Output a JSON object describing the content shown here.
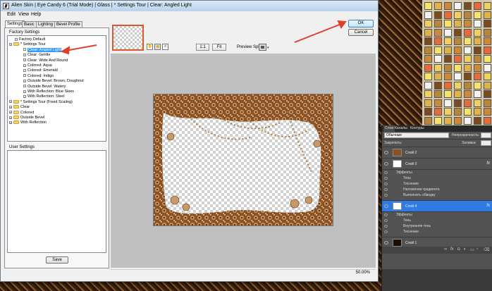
{
  "window": {
    "title": "Alien Skin | Eye Candy 6 (Trial Mode) | Glass | * Settings Tour | Clear: Angled Light"
  },
  "menu": {
    "edit": "Edit",
    "view": "View",
    "help": "Help"
  },
  "tabs": [
    "Settings",
    "Basic",
    "Lighting",
    "Bevel Profile"
  ],
  "factory_settings": {
    "label": "Factory Settings",
    "items": [
      {
        "label": "Factory Default",
        "type": "leaf",
        "indent": 1
      },
      {
        "label": "* Settings Tour",
        "type": "folder-open",
        "indent": 0
      },
      {
        "label": "Clear: Angled Light",
        "type": "leaf",
        "indent": 2,
        "selected": true
      },
      {
        "label": "Clear: Gentle",
        "type": "leaf",
        "indent": 2
      },
      {
        "label": "Clear: Wide And Round",
        "type": "leaf",
        "indent": 2
      },
      {
        "label": "Colored: Aqua",
        "type": "leaf",
        "indent": 2
      },
      {
        "label": "Colored: Emerald",
        "type": "leaf",
        "indent": 2
      },
      {
        "label": "Colored: Indigo",
        "type": "leaf",
        "indent": 2
      },
      {
        "label": "Outside Bevel: Brown, Doughnut",
        "type": "leaf",
        "indent": 2
      },
      {
        "label": "Outside Bevel: Watery",
        "type": "leaf",
        "indent": 2
      },
      {
        "label": "With Reflection: Blue Skies",
        "type": "leaf",
        "indent": 2
      },
      {
        "label": "With Reflection: Steel",
        "type": "leaf",
        "indent": 2
      },
      {
        "label": "* Settings Tour (Fixed Scaling)",
        "type": "folder",
        "indent": 0
      },
      {
        "label": "Clear",
        "type": "folder",
        "indent": 0
      },
      {
        "label": "Colored",
        "type": "folder",
        "indent": 0
      },
      {
        "label": "Outside Bevel",
        "type": "folder",
        "indent": 0
      },
      {
        "label": "With Reflection",
        "type": "folder",
        "indent": 0
      }
    ]
  },
  "user_settings": {
    "label": "User Settings"
  },
  "save_button": "Save",
  "ok_button": "OK",
  "cancel_button": "Cancel",
  "toolbar": {
    "zoom_1_1": "1:1",
    "fit": "Fit",
    "preview_split_label": "Preview Split:"
  },
  "status": {
    "zoom": "50.00%"
  },
  "ps": {
    "tabs": [
      "Слои",
      "Каналы",
      "Контуры"
    ],
    "blend_mode": "Обычные",
    "opacity_label": "Непрозрачность:",
    "lock_label": "Закрепить:",
    "fill_label": "Заливка:",
    "layers": [
      {
        "name": "Слой 2",
        "fx": false
      },
      {
        "name": "Слой 3",
        "fx": true,
        "effects_label": "Эффекты",
        "effects": [
          "Тень",
          "Тиснение",
          "Наложение градиента",
          "Выполнить обводку"
        ]
      },
      {
        "name": "Слой 4",
        "fx": true,
        "selected": true,
        "effects_label": "Эффекты",
        "effects": [
          "Тень",
          "Внутренняя тень",
          "Тиснение"
        ]
      },
      {
        "name": "Слой 1",
        "fx": false
      }
    ],
    "fx_glyph": "fx"
  },
  "colors": {
    "accent_selection": "#3399ff",
    "ps_selected_layer": "#2f7ae5",
    "arrow": "#e0402a",
    "frame_brown": "#8a5224"
  }
}
